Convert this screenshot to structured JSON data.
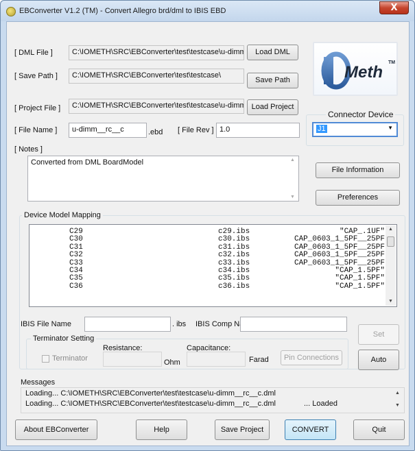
{
  "window": {
    "title": "EBConverter V1.2 (TM) - Convert Allegro brd/dml to IBIS EBD",
    "close_label": "X"
  },
  "files": {
    "dml_label": "[ DML File ]",
    "dml_value": "C:\\IOMETH\\SRC\\EBConverter\\test\\testcase\\u-dimm_",
    "load_dml": "Load DML",
    "save_label": "[ Save Path ]",
    "save_value": "C:\\IOMETH\\SRC\\EBConverter\\test\\testcase\\",
    "save_path": "Save Path",
    "project_label": "[ Project File ]",
    "project_value": "C:\\IOMETH\\SRC\\EBConverter\\test\\testcase\\u-dimm_",
    "load_project": "Load Project",
    "filename_label": "[ File Name ]",
    "filename_value": "u-dimm__rc__c",
    "ebd_ext": ".ebd",
    "filerev_label": "[ File Rev ]",
    "filerev_value": "1.0",
    "notes_label": "[ Notes ]",
    "notes_value": "Converted from DML BoardModel"
  },
  "logo": {
    "brand": "IOMeth",
    "tm": "TM"
  },
  "connector": {
    "label": "Connector Device",
    "value": "J1"
  },
  "side_buttons": {
    "file_info": "File Information",
    "preferences": "Preferences"
  },
  "mapping": {
    "title": "Device Model Mapping",
    "rows": [
      {
        "device": "C29",
        "file": "c29.ibs",
        "model": "\"CAP_.1UF\""
      },
      {
        "device": "C30",
        "file": "c30.ibs",
        "model": "CAP_0603_1_5PF__25PF"
      },
      {
        "device": "C31",
        "file": "c31.ibs",
        "model": "CAP_0603_1_5PF__25PF"
      },
      {
        "device": "C32",
        "file": "c32.ibs",
        "model": "CAP_0603_1_5PF__25PF"
      },
      {
        "device": "C33",
        "file": "c33.ibs",
        "model": "CAP_0603_1_5PF__25PF"
      },
      {
        "device": "C34",
        "file": "c34.ibs",
        "model": "\"CAP_1.5PF\""
      },
      {
        "device": "C35",
        "file": "c35.ibs",
        "model": "\"CAP_1.5PF\""
      },
      {
        "device": "C36",
        "file": "c36.ibs",
        "model": "\"CAP_1.5PF\""
      }
    ],
    "ibis_file_label": "IBIS File Name",
    "ibs_ext": ". ibs",
    "ibis_comp_label": "IBIS Comp Name",
    "set_button": "Set",
    "auto_button": "Auto"
  },
  "terminator": {
    "title": "Terminator Setting",
    "checkbox_label": "Terminator",
    "resistance_label": "Resistance:",
    "ohm_unit": "Ohm",
    "capacitance_label": "Capacitance:",
    "farad_unit": "Farad",
    "pin_connections": "Pin Connections"
  },
  "messages": {
    "title": "Messages",
    "lines": [
      {
        "text": "Loading... C:\\IOMETH\\SRC\\EBConverter\\test\\testcase\\u-dimm__rc__c.dml",
        "status": ""
      },
      {
        "text": "Loading... C:\\IOMETH\\SRC\\EBConverter\\test\\testcase\\u-dimm__rc__c.dml",
        "status": "... Loaded"
      }
    ]
  },
  "bottom": {
    "about": "About EBConverter",
    "help": "Help",
    "save_project": "Save Project",
    "convert": "CONVERT",
    "quit": "Quit"
  },
  "colors": {
    "accent": "#3399ff",
    "logo_blue": "#3a6fb0",
    "window_frame": "#c9dbef"
  }
}
